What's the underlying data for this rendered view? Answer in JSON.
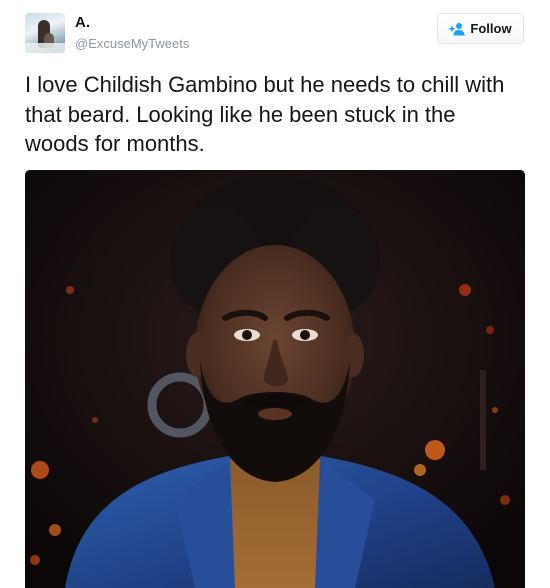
{
  "tweet": {
    "author": {
      "name": "A.",
      "handle": "@ExcuseMyTweets"
    },
    "follow_label": "Follow",
    "text": "I love Childish Gambino but he needs to chill with that beard. Looking like he been stuck in the woods for months.",
    "icons": {
      "follow": "follow-plus-person-icon"
    },
    "colors": {
      "text": "#14171a",
      "secondary": "#8899a6",
      "accent": "#1da1f2",
      "border": "#e1e8ed"
    }
  }
}
